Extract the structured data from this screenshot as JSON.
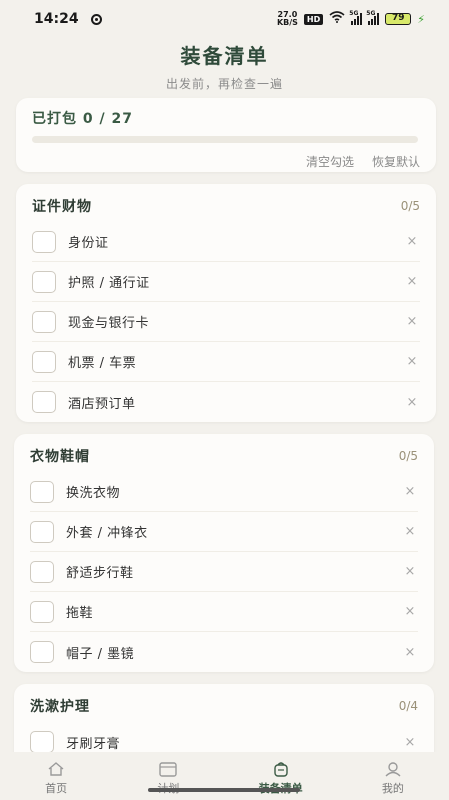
{
  "status": {
    "time": "14:24",
    "net_speed_value": "27.0",
    "net_speed_unit": "KB/S",
    "hd_label": "HD",
    "sig1_tag": "5G",
    "sig2_tag": "5G",
    "battery": "79"
  },
  "header": {
    "title": "装备清单",
    "subtitle": "出发前，再检查一遍"
  },
  "progress": {
    "packed_label": "已打包 0 / 27",
    "fraction": 0,
    "clear_label": "清空勾选",
    "reset_label": "恢复默认"
  },
  "categories": [
    {
      "title": "证件财物",
      "count": "0/5",
      "items": [
        "身份证",
        "护照 / 通行证",
        "现金与银行卡",
        "机票 / 车票",
        "酒店预订单"
      ]
    },
    {
      "title": "衣物鞋帽",
      "count": "0/5",
      "items": [
        "换洗衣物",
        "外套 / 冲锋衣",
        "舒适步行鞋",
        "拖鞋",
        "帽子 / 墨镜"
      ]
    },
    {
      "title": "洗漱护理",
      "count": "0/4",
      "items": [
        "牙刷牙膏"
      ]
    }
  ],
  "remove_glyph": "×",
  "nav": {
    "home": "首页",
    "plan": "计划",
    "packing": "装备清单",
    "mine": "我的"
  },
  "colors": {
    "accent": "#3a5a44",
    "background": "#f3f1ec",
    "card": "#fdfcfa"
  }
}
